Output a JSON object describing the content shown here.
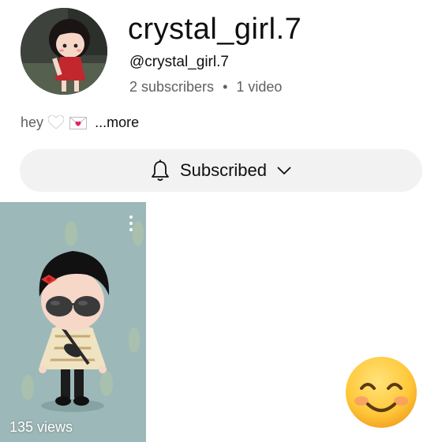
{
  "channel": {
    "name": "crystal_girl.7",
    "handle": "@crystal_girl.7",
    "subscribers": "2 subscribers",
    "separator": "•",
    "videos": "1 video"
  },
  "bio": {
    "text": "hey",
    "emojis": [
      "white-heart-icon",
      "love-letter-icon"
    ],
    "more_label": "...more"
  },
  "subscribe_button": {
    "label": "Subscribed",
    "icon": "bell-icon",
    "dropdown_icon": "chevron-down-icon"
  },
  "videos": [
    {
      "views": "135 views",
      "menu_icon": "more-vert-icon"
    }
  ],
  "sticker": {
    "icon": "smiling-face-emoji"
  },
  "colors": {
    "button_bg": "#f2f2f2",
    "secondary_text": "#606060",
    "thumbnail_bg": "#9db8b8"
  }
}
